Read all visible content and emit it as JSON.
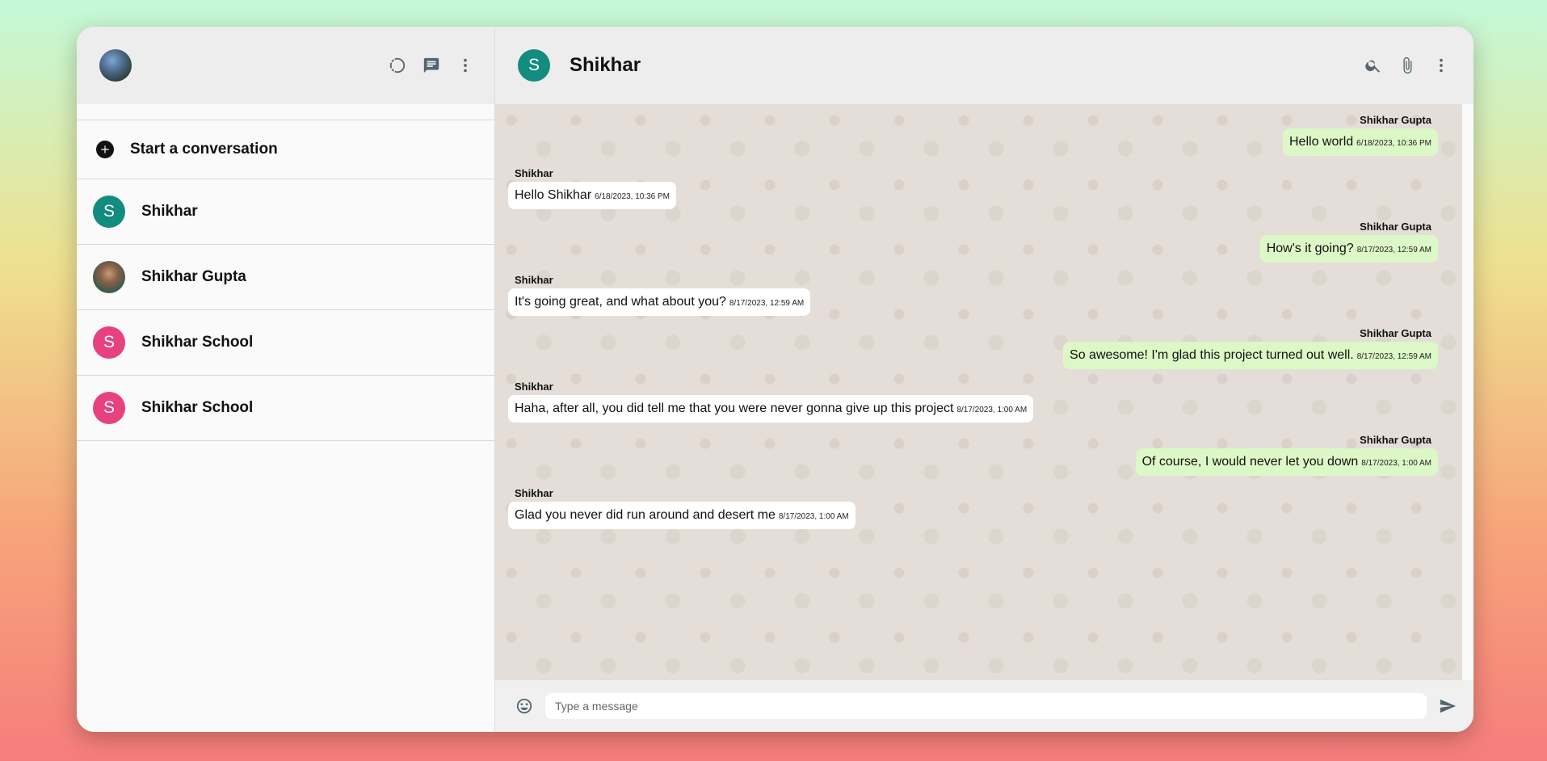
{
  "sidebar": {
    "start_label": "Start a conversation",
    "chats": [
      {
        "name": "Shikhar",
        "initial": "S",
        "color": "#128c7e",
        "photo": false
      },
      {
        "name": "Shikhar Gupta",
        "initial": "",
        "color": "",
        "photo": true
      },
      {
        "name": "Shikhar School",
        "initial": "S",
        "color": "#e8417f",
        "photo": false
      },
      {
        "name": "Shikhar School",
        "initial": "S",
        "color": "#e8417f",
        "photo": false
      }
    ],
    "header_icons": [
      "status-icon",
      "new-chat-icon",
      "menu-icon"
    ]
  },
  "chat": {
    "title": "Shikhar",
    "initial": "S",
    "avatar_color": "#128c7e",
    "header_icons": [
      "search-icon",
      "attach-icon",
      "menu-icon"
    ],
    "messages": [
      {
        "dir": "out",
        "sender": "Shikhar Gupta",
        "text": "Hello world",
        "time": "6/18/2023, 10:36 PM"
      },
      {
        "dir": "in",
        "sender": "Shikhar",
        "text": "Hello Shikhar",
        "time": "6/18/2023, 10:36 PM"
      },
      {
        "dir": "out",
        "sender": "Shikhar Gupta",
        "text": "How's it going?",
        "time": "8/17/2023, 12:59 AM"
      },
      {
        "dir": "in",
        "sender": "Shikhar",
        "text": "It's going great, and what about you?",
        "time": "8/17/2023, 12:59 AM"
      },
      {
        "dir": "out",
        "sender": "Shikhar Gupta",
        "text": "So awesome! I'm glad this project turned out well.",
        "time": "8/17/2023, 12:59 AM"
      },
      {
        "dir": "in",
        "sender": "Shikhar",
        "text": "Haha, after all, you did tell me that you were never gonna give up this project",
        "time": "8/17/2023, 1:00 AM"
      },
      {
        "dir": "out",
        "sender": "Shikhar Gupta",
        "text": "Of course, I would never let you down",
        "time": "8/17/2023, 1:00 AM"
      },
      {
        "dir": "in",
        "sender": "Shikhar",
        "text": "Glad you never did run around and desert me",
        "time": "8/17/2023, 1:00 AM"
      }
    ]
  },
  "composer": {
    "placeholder": "Type a message",
    "value": ""
  },
  "colors": {
    "outgoing_bubble": "#dcf8c6",
    "incoming_bubble": "#ffffff",
    "header_bg": "#ededed",
    "accent": "#128c7e"
  }
}
